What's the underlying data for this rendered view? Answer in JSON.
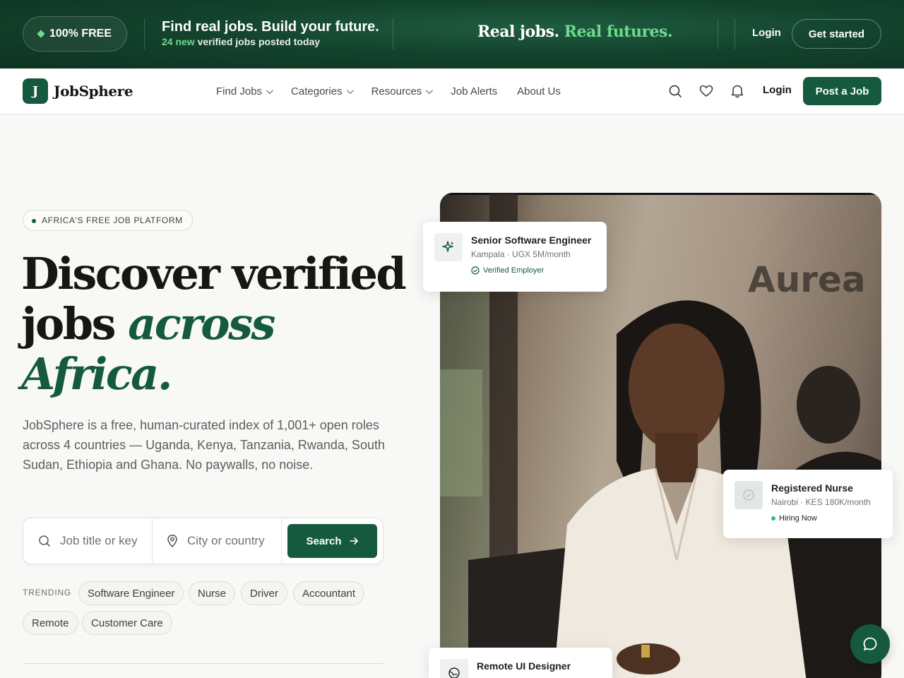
{
  "promo": {
    "badge": "100% FREE",
    "headline": "Find real jobs. Build your future.",
    "sub_count": "24 new",
    "sub_rest": "verified jobs posted today",
    "slogan_a": "Real jobs.",
    "slogan_b": "Real futures.",
    "login": "Login",
    "get_started": "Get started"
  },
  "nav": {
    "logo_letter": "J",
    "logo_text": "JobSphere",
    "links": [
      {
        "label": "Find Jobs",
        "dropdown": true
      },
      {
        "label": "Categories",
        "dropdown": true
      },
      {
        "label": "Resources",
        "dropdown": true
      },
      {
        "label": "Job Alerts",
        "dropdown": false
      },
      {
        "label": "About Us",
        "dropdown": false
      }
    ],
    "icons": [
      "search-icon",
      "heart-icon",
      "bell-icon"
    ],
    "login": "Login",
    "post_job": "Post a Job"
  },
  "hero": {
    "eyebrow": "AFRICA'S FREE JOB PLATFORM",
    "title_line1": "Discover verified",
    "title_line2a": "jobs ",
    "title_line2b": "across",
    "title_line3": "Africa.",
    "description": "JobSphere is a free, human-curated index of 1,001+ open roles across 4 countries — Uganda, Kenya, Tanzania, Rwanda, South Sudan, Ethiopia and Ghana. No paywalls, no noise.",
    "search": {
      "keyword_placeholder": "Job title or key",
      "location_placeholder": "City or country",
      "button": "Search"
    },
    "trending_label": "TRENDING",
    "trending": [
      "Software Engineer",
      "Nurse",
      "Driver",
      "Accountant",
      "Remote",
      "Customer Care"
    ]
  },
  "photo": {
    "sign_text": "Aurea"
  },
  "cards": [
    {
      "title": "Senior Software Engineer",
      "sub": "Kampala · UGX 5M/month",
      "badge": "Verified Employer",
      "icon": "sparkle-icon"
    },
    {
      "title": "Registered Nurse",
      "sub": "Nairobi · KES 180K/month",
      "badge": "Hiring Now",
      "icon": "check-circle-icon"
    },
    {
      "title": "Remote UI Designer",
      "sub": "",
      "badge": "",
      "icon": "globe-icon"
    }
  ],
  "colors": {
    "brand": "#155a3e",
    "accent_green": "#6fd98f",
    "banner_bg": "#13432d"
  }
}
